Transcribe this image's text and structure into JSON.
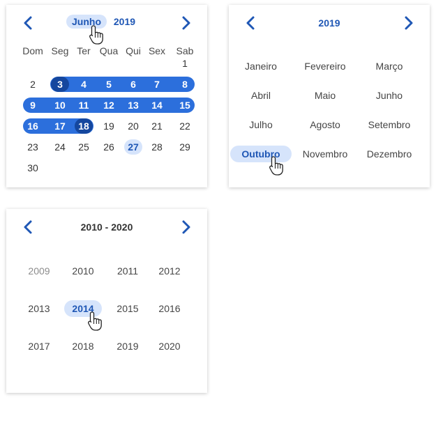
{
  "day_view": {
    "month": "Junho",
    "year": "2019",
    "weekdays": [
      "Dom",
      "Seg",
      "Ter",
      "Qua",
      "Qui",
      "Sex",
      "Sab"
    ],
    "weeks": [
      [
        "",
        "",
        "",
        "",
        "",
        "",
        "1"
      ],
      [
        "2",
        "3",
        "4",
        "5",
        "6",
        "7",
        "8"
      ],
      [
        "9",
        "10",
        "11",
        "12",
        "13",
        "14",
        "15"
      ],
      [
        "16",
        "17",
        "18",
        "19",
        "20",
        "21",
        "22"
      ],
      [
        "23",
        "24",
        "25",
        "26",
        "27",
        "28",
        "29"
      ],
      [
        "30",
        "",
        "",
        "",
        "",
        "",
        ""
      ]
    ],
    "range_start": "3",
    "range_end": "18",
    "today": "27"
  },
  "month_view": {
    "year": "2019",
    "months": [
      "Janeiro",
      "Fevereiro",
      "Março",
      "Abril",
      "Maio",
      "Junho",
      "Julho",
      "Agosto",
      "Setembro",
      "Outubro",
      "Novembro",
      "Dezembro"
    ],
    "active": "Outubro"
  },
  "year_view": {
    "range_label": "2010 - 2020",
    "years": [
      "2009",
      "2010",
      "2011",
      "2012",
      "2013",
      "2014",
      "2015",
      "2016",
      "2017",
      "2018",
      "2019",
      "2020"
    ],
    "active": "2014",
    "muted": "2009"
  },
  "colors": {
    "accent": "#1f57b5",
    "range": "#2c6fdc",
    "selected": "#15479e",
    "highlight": "#d6e4fb"
  }
}
